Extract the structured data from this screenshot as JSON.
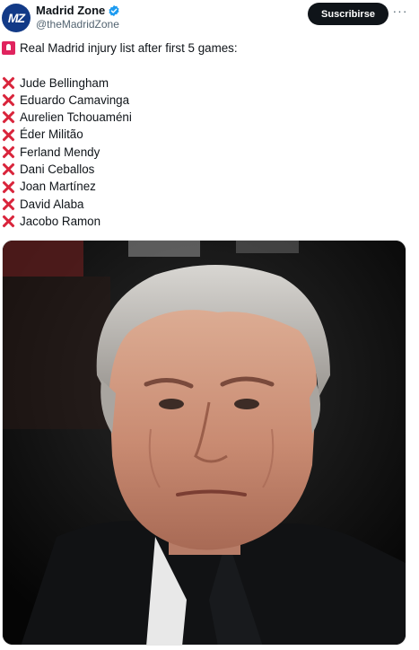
{
  "account": {
    "display_name": "Madrid Zone",
    "handle": "@theMadridZone",
    "avatar_text": "MZ",
    "subscribe_label": "Suscribirse",
    "more_label": "···"
  },
  "tweet": {
    "headline": "Real Madrid injury list after first 5 games:",
    "headline_icon": "siren-emoji",
    "list_icon": "cross-mark-emoji",
    "injured": [
      "Jude Bellingham",
      "Eduardo Camavinga",
      "Aurelien Tchouaméni",
      "Éder Militão",
      "Ferland Mendy",
      "Dani Ceballos",
      "Joan Martínez",
      "David Alaba",
      "Jacobo Ramon"
    ]
  },
  "colors": {
    "text": "#0f1419",
    "secondary_text": "#536471",
    "verified_blue": "#1d9bf0",
    "cross_red": "#d9243b",
    "button_bg": "#0f1419"
  }
}
